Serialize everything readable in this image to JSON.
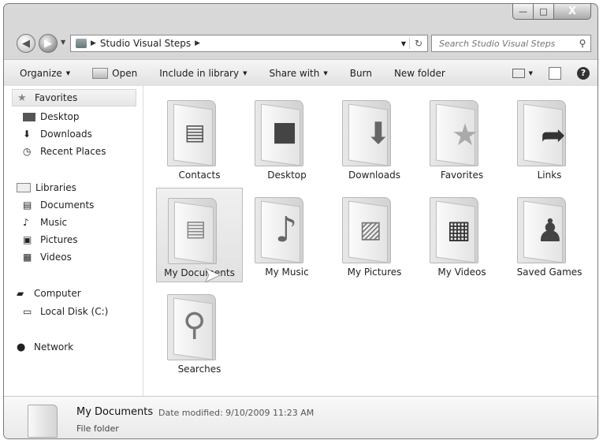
{
  "window": {
    "caption": {
      "minimize": "—",
      "maximize": "□",
      "close": "X"
    }
  },
  "address": {
    "path": "Studio Visual Steps",
    "separator": "▶"
  },
  "search": {
    "placeholder": "Search Studio Visual Steps"
  },
  "toolbar": {
    "organize": "Organize",
    "open": "Open",
    "include": "Include in library",
    "share": "Share with",
    "burn": "Burn",
    "new_folder": "New folder",
    "help": "?"
  },
  "nav": {
    "favorites": "Favorites",
    "desktop": "Desktop",
    "downloads": "Downloads",
    "recent": "Recent Places",
    "libraries": "Libraries",
    "documents": "Documents",
    "music": "Music",
    "pictures": "Pictures",
    "videos": "Videos",
    "computer": "Computer",
    "local_disk": "Local Disk (C:)",
    "network": "Network"
  },
  "folders": [
    {
      "label": "Contacts",
      "icon": "contact-card-icon"
    },
    {
      "label": "Desktop",
      "icon": "monitor-icon"
    },
    {
      "label": "Downloads",
      "icon": "down-arrow-icon"
    },
    {
      "label": "Favorites",
      "icon": "star-icon"
    },
    {
      "label": "Links",
      "icon": "link-arrow-icon"
    },
    {
      "label": "My Documents",
      "icon": "document-icon"
    },
    {
      "label": "My Music",
      "icon": "music-note-icon"
    },
    {
      "label": "My Pictures",
      "icon": "picture-icon"
    },
    {
      "label": "My Videos",
      "icon": "film-icon"
    },
    {
      "label": "Saved Games",
      "icon": "chess-pawn-icon"
    },
    {
      "label": "Searches",
      "icon": "magnifier-icon"
    }
  ],
  "details": {
    "name": "My Documents",
    "meta": "Date modified: 9/10/2009 11:23 AM",
    "type": "File folder"
  }
}
